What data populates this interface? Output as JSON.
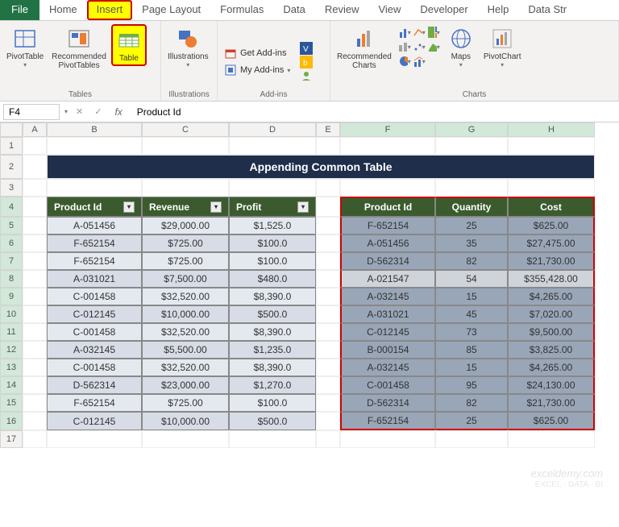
{
  "ribbon": {
    "file": "File",
    "tabs": [
      "Home",
      "Insert",
      "Page Layout",
      "Formulas",
      "Data",
      "Review",
      "View",
      "Developer",
      "Help",
      "Data Str"
    ],
    "active": "Insert",
    "groups": {
      "tables": {
        "label": "Tables",
        "pivottable": "PivotTable",
        "recommended_pivots": "Recommended\nPivotTables",
        "table": "Table"
      },
      "illustrations": {
        "label": "Illustrations",
        "btn": "Illustrations"
      },
      "addins": {
        "label": "Add-ins",
        "get": "Get Add-ins",
        "my": "My Add-ins"
      },
      "charts": {
        "label": "Charts",
        "recommended": "Recommended\nCharts",
        "maps": "Maps",
        "pivotchart": "PivotChart"
      }
    }
  },
  "formula": {
    "name_box": "F4",
    "fx": "fx",
    "value": "Product Id"
  },
  "columns": [
    "A",
    "B",
    "C",
    "D",
    "E",
    "F",
    "G",
    "H"
  ],
  "title": "Appending Common Table",
  "left_table": {
    "headers": [
      "Product Id",
      "Revenue",
      "Profit"
    ],
    "rows": [
      [
        "A-051456",
        "$29,000.00",
        "$1,525.0"
      ],
      [
        "F-652154",
        "$725.00",
        "$100.0"
      ],
      [
        "F-652154",
        "$725.00",
        "$100.0"
      ],
      [
        "A-031021",
        "$7,500.00",
        "$480.0"
      ],
      [
        "C-001458",
        "$32,520.00",
        "$8,390.0"
      ],
      [
        "C-012145",
        "$10,000.00",
        "$500.0"
      ],
      [
        "C-001458",
        "$32,520.00",
        "$8,390.0"
      ],
      [
        "A-032145",
        "$5,500.00",
        "$1,235.0"
      ],
      [
        "C-001458",
        "$32,520.00",
        "$8,390.0"
      ],
      [
        "D-562314",
        "$23,000.00",
        "$1,270.0"
      ],
      [
        "F-652154",
        "$725.00",
        "$100.0"
      ],
      [
        "C-012145",
        "$10,000.00",
        "$500.0"
      ]
    ]
  },
  "right_table": {
    "headers": [
      "Product Id",
      "Quantity",
      "Cost"
    ],
    "rows": [
      [
        "F-652154",
        "25",
        "$625.00"
      ],
      [
        "A-051456",
        "35",
        "$27,475.00"
      ],
      [
        "D-562314",
        "82",
        "$21,730.00"
      ],
      [
        "A-021547",
        "54",
        "$355,428.00"
      ],
      [
        "A-032145",
        "15",
        "$4,265.00"
      ],
      [
        "A-031021",
        "45",
        "$7,020.00"
      ],
      [
        "C-012145",
        "73",
        "$9,500.00"
      ],
      [
        "B-000154",
        "85",
        "$3,825.00"
      ],
      [
        "A-032145",
        "15",
        "$4,265.00"
      ],
      [
        "C-001458",
        "95",
        "$24,130.00"
      ],
      [
        "D-562314",
        "82",
        "$21,730.00"
      ],
      [
        "F-652154",
        "25",
        "$625.00"
      ]
    ]
  },
  "row_numbers": [
    1,
    2,
    3,
    4,
    5,
    6,
    7,
    8,
    9,
    10,
    11,
    12,
    13,
    14,
    15,
    16,
    17
  ],
  "watermark": {
    "line1": "exceldemy.com",
    "line2": "EXCEL · DATA · BI"
  }
}
